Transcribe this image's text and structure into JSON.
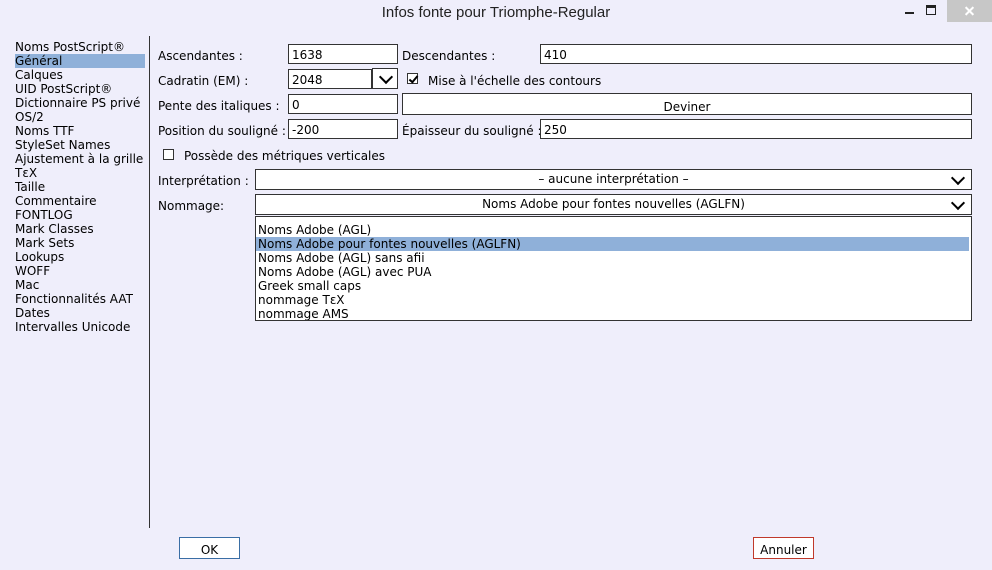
{
  "window": {
    "title": "Infos fonte pour Triomphe-Regular"
  },
  "sidebar": {
    "items": [
      {
        "label": "Noms PostScript®"
      },
      {
        "label": "Général"
      },
      {
        "label": "Calques"
      },
      {
        "label": "UID PostScript®"
      },
      {
        "label": "Dictionnaire PS privé"
      },
      {
        "label": "OS/2"
      },
      {
        "label": "Noms TTF"
      },
      {
        "label": "StyleSet Names"
      },
      {
        "label": "Ajustement à la grille"
      },
      {
        "label": "TεX"
      },
      {
        "label": "Taille"
      },
      {
        "label": "Commentaire"
      },
      {
        "label": "FONTLOG"
      },
      {
        "label": "Mark Classes"
      },
      {
        "label": "Mark Sets"
      },
      {
        "label": "Lookups"
      },
      {
        "label": "WOFF"
      },
      {
        "label": "Mac"
      },
      {
        "label": "Fonctionnalités AAT"
      },
      {
        "label": "Dates"
      },
      {
        "label": "Intervalles Unicode"
      }
    ],
    "selected": "Général"
  },
  "form": {
    "ascent_label": "Ascendantes :",
    "ascent_value": "1638",
    "descent_label": "Descendantes :",
    "descent_value": "410",
    "em_label": "Cadratin (EM) :",
    "em_value": "2048",
    "scale_label": "Mise à l'échelle des contours",
    "scale_checked": true,
    "italic_label": "Pente des italiques :",
    "italic_value": "0",
    "guess_label": "Deviner",
    "underline_pos_label": "Position du souligné :",
    "underline_pos_value": "-200",
    "underline_width_label": "Épaisseur du souligné :",
    "underline_width_value": "250",
    "vertical_label": "Possède des métriques verticales",
    "vertical_checked": false,
    "interpretation_label": "Interprétation :",
    "interpretation_value": "– aucune interprétation –",
    "naming_label": "Nommage:",
    "naming_value": "Noms Adobe pour fontes nouvelles (AGLFN)",
    "naming_options": [
      "Noms Adobe (AGL)",
      "Noms Adobe pour fontes nouvelles (AGLFN)",
      "Noms Adobe (AGL) sans afii",
      "Noms Adobe (AGL) avec PUA",
      "Greek small caps",
      "nommage TεX",
      "nommage AMS"
    ]
  },
  "buttons": {
    "ok": "OK",
    "cancel": "Annuler"
  },
  "colors": {
    "background": "#efeefb",
    "selection": "#8fb0d9",
    "cancel_border": "#c0392b"
  }
}
